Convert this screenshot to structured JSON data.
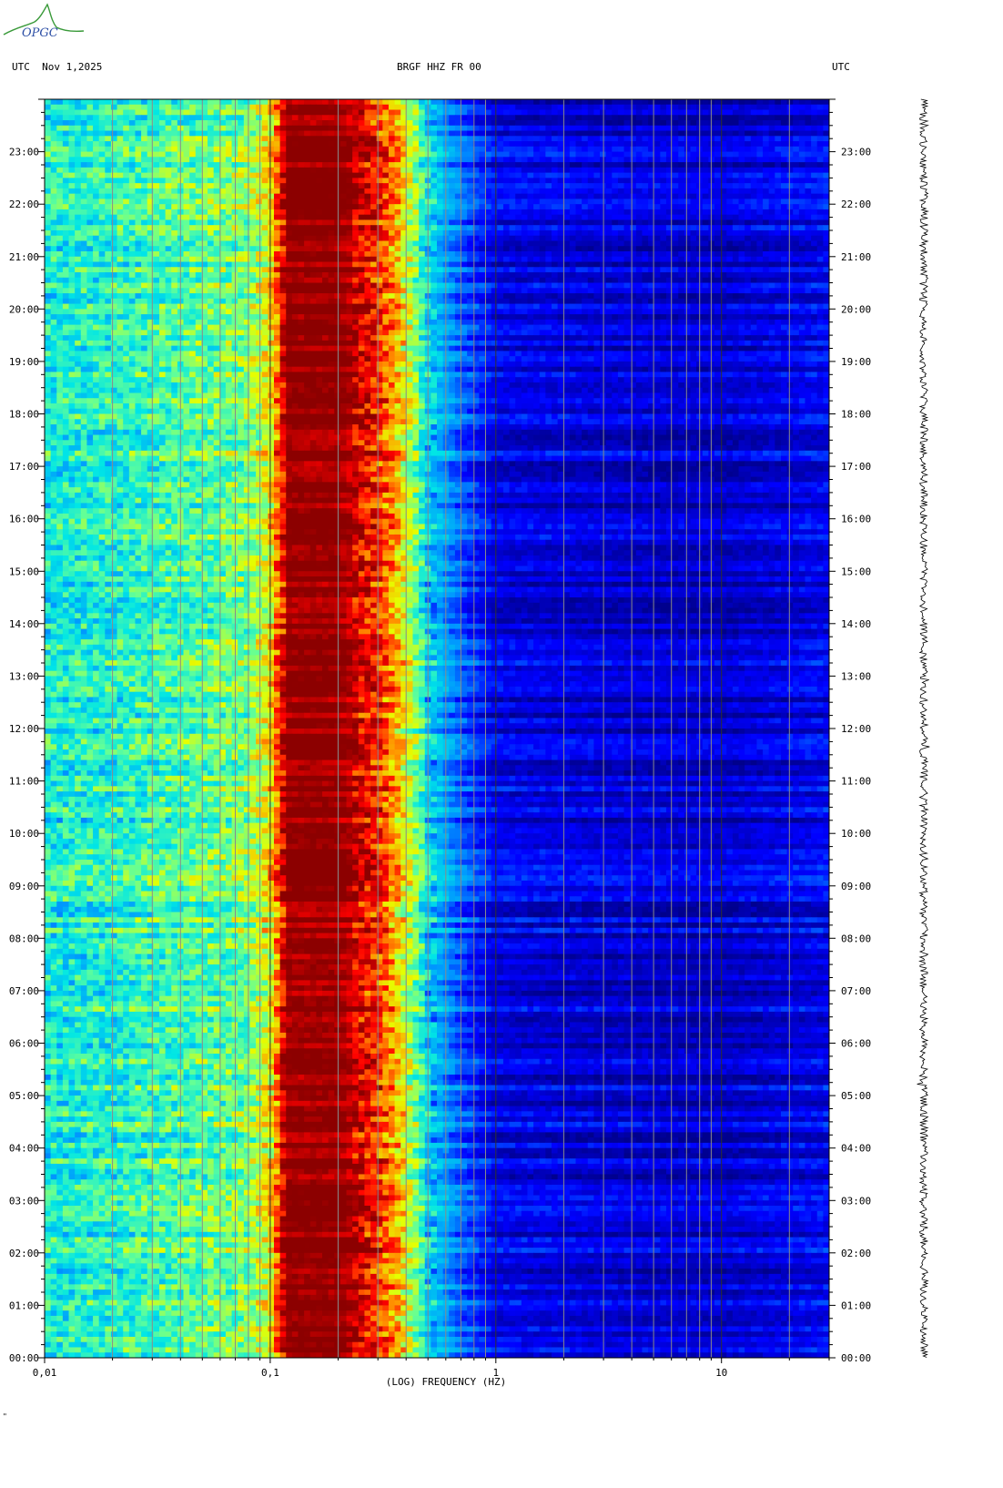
{
  "header": {
    "left_label": "UTC  Nov 1,2025",
    "center_label": "BRGF HHZ FR 00",
    "right_label": "UTC",
    "logo_text": "OPGC"
  },
  "footer": {
    "mark": "\""
  },
  "colors": {
    "background": "#ffffff",
    "spectrogram_low": "#00008c",
    "spectrogram_mid": "#00d2f0",
    "spectrogram_high": "#e6ff00",
    "spectrogram_peak": "#8c0000",
    "logo_green": "#3a9a3a",
    "logo_blue": "#2d4fa6"
  },
  "chart_data": {
    "type": "heatmap",
    "title": "BRGF HHZ FR 00",
    "xlabel": "(LOG) FREQUENCY (HZ)",
    "xscale": "log",
    "xlim": [
      0.01,
      30
    ],
    "x_ticks": [
      "0,01",
      "0,1",
      "1",
      "10"
    ],
    "x_tick_values": [
      0.01,
      0.1,
      1,
      10
    ],
    "ylabel": "UTC",
    "ylim_hours": [
      0,
      24
    ],
    "y_ticks": [
      "00:00",
      "01:00",
      "02:00",
      "03:00",
      "04:00",
      "05:00",
      "06:00",
      "07:00",
      "08:00",
      "09:00",
      "10:00",
      "11:00",
      "12:00",
      "13:00",
      "14:00",
      "15:00",
      "16:00",
      "17:00",
      "18:00",
      "19:00",
      "20:00",
      "21:00",
      "22:00",
      "23:00"
    ],
    "spectrum_profile": {
      "freq_hz": [
        0.01,
        0.02,
        0.05,
        0.08,
        0.1,
        0.12,
        0.2,
        0.3,
        0.35,
        0.45,
        0.5,
        0.7,
        1,
        3,
        10,
        30
      ],
      "level": [
        0.4,
        0.42,
        0.48,
        0.52,
        0.65,
        1.0,
        1.0,
        0.85,
        0.75,
        0.5,
        0.35,
        0.2,
        0.1,
        0.08,
        0.07,
        0.11
      ]
    },
    "colormap": [
      "#00008c",
      "#0000ff",
      "#0096ff",
      "#00e6e6",
      "#64ff96",
      "#e6ff00",
      "#ff9600",
      "#ff0000",
      "#8c0000"
    ],
    "legend": "none",
    "grid": true,
    "trace": "waveform trace at right edge"
  }
}
